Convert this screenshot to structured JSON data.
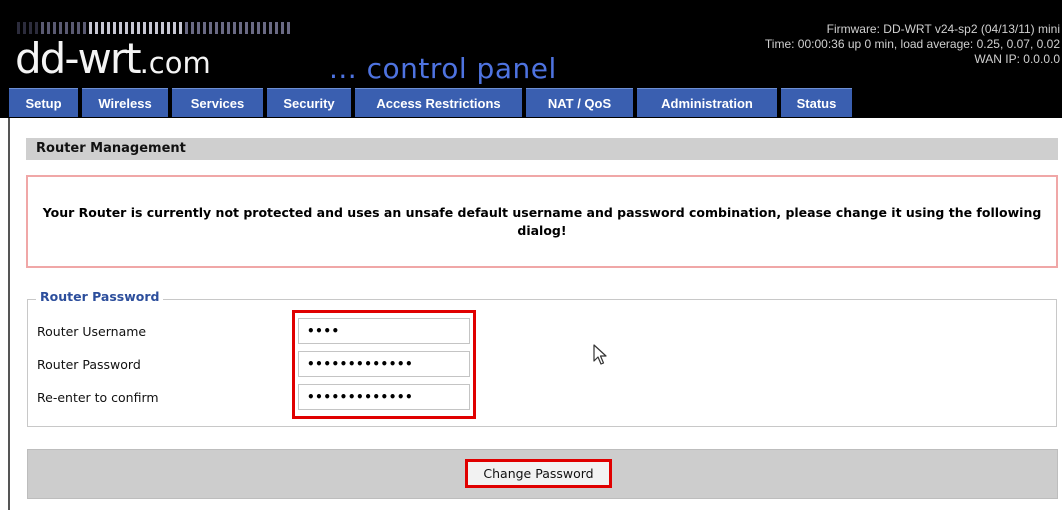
{
  "header": {
    "logo_main": "dd-wrt",
    "logo_suffix": ".com",
    "subtitle": "... control panel",
    "firmware": "Firmware: DD-WRT v24-sp2 (04/13/11) mini",
    "time": "Time: 00:00:36 up 0 min, load average: 0.25, 0.07, 0.02",
    "wan_ip": "WAN IP: 0.0.0.0"
  },
  "tabs": [
    {
      "label": "Setup"
    },
    {
      "label": "Wireless"
    },
    {
      "label": "Services"
    },
    {
      "label": "Security"
    },
    {
      "label": "Access Restrictions"
    },
    {
      "label": "NAT / QoS"
    },
    {
      "label": "Administration"
    },
    {
      "label": "Status"
    }
  ],
  "section_title": "Router Management",
  "warning": "Your Router is currently not protected and uses an unsafe default username and password combination, please change it using the following dialog!",
  "form": {
    "legend": "Router Password",
    "username_label": "Router Username",
    "username_value": "••••",
    "password_label": "Router Password",
    "password_value": "•••••••••••••",
    "confirm_label": "Re-enter to confirm",
    "confirm_value": "•••••••••••••"
  },
  "button": {
    "change_password": "Change Password"
  },
  "colors": {
    "tab_bg": "#3a5fb0",
    "header_bg": "#000000",
    "accent_blue": "#4e73e0",
    "highlight_red": "#e00000",
    "warning_border": "#f0a7a7"
  }
}
